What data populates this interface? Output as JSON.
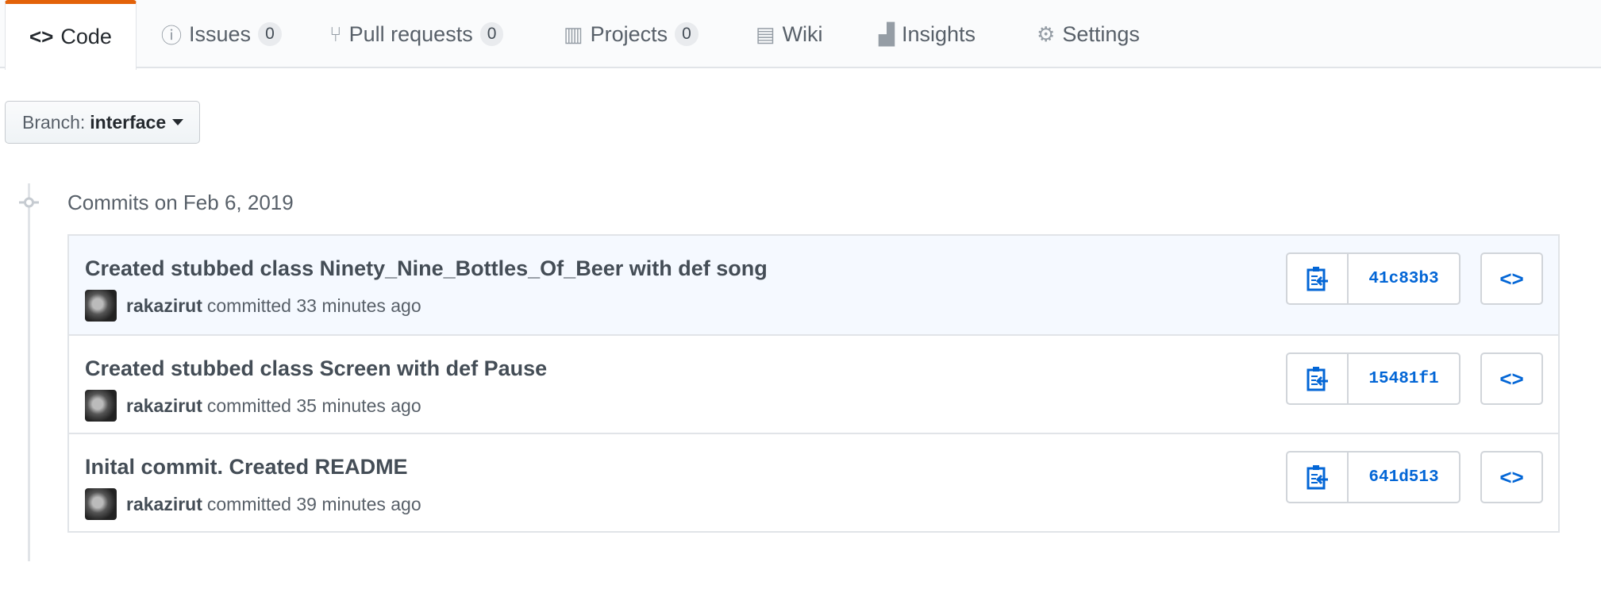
{
  "tabs": [
    {
      "label": "Code",
      "icon": "code-icon"
    },
    {
      "label": "Issues",
      "count": "0",
      "icon": "issue-icon"
    },
    {
      "label": "Pull requests",
      "count": "0",
      "icon": "pull-request-icon"
    },
    {
      "label": "Projects",
      "count": "0",
      "icon": "project-icon"
    },
    {
      "label": "Wiki",
      "icon": "book-icon"
    },
    {
      "label": "Insights",
      "icon": "graph-icon"
    },
    {
      "label": "Settings",
      "icon": "gear-icon"
    }
  ],
  "branch": {
    "label": "Branch:",
    "value": "interface"
  },
  "commits_date": "Commits on Feb 6, 2019",
  "commits": [
    {
      "title": "Created stubbed class Ninety_Nine_Bottles_Of_Beer with def song",
      "author": "rakazirut",
      "time": "committed 33 minutes ago",
      "sha": "41c83b3"
    },
    {
      "title": "Created stubbed class Screen with def Pause",
      "author": "rakazirut",
      "time": "committed 35 minutes ago",
      "sha": "15481f1"
    },
    {
      "title": "Inital commit. Created README",
      "author": "rakazirut",
      "time": "committed 39 minutes ago",
      "sha": "641d513"
    }
  ],
  "colors": {
    "accent": "#e36209",
    "link": "#0366d6"
  }
}
